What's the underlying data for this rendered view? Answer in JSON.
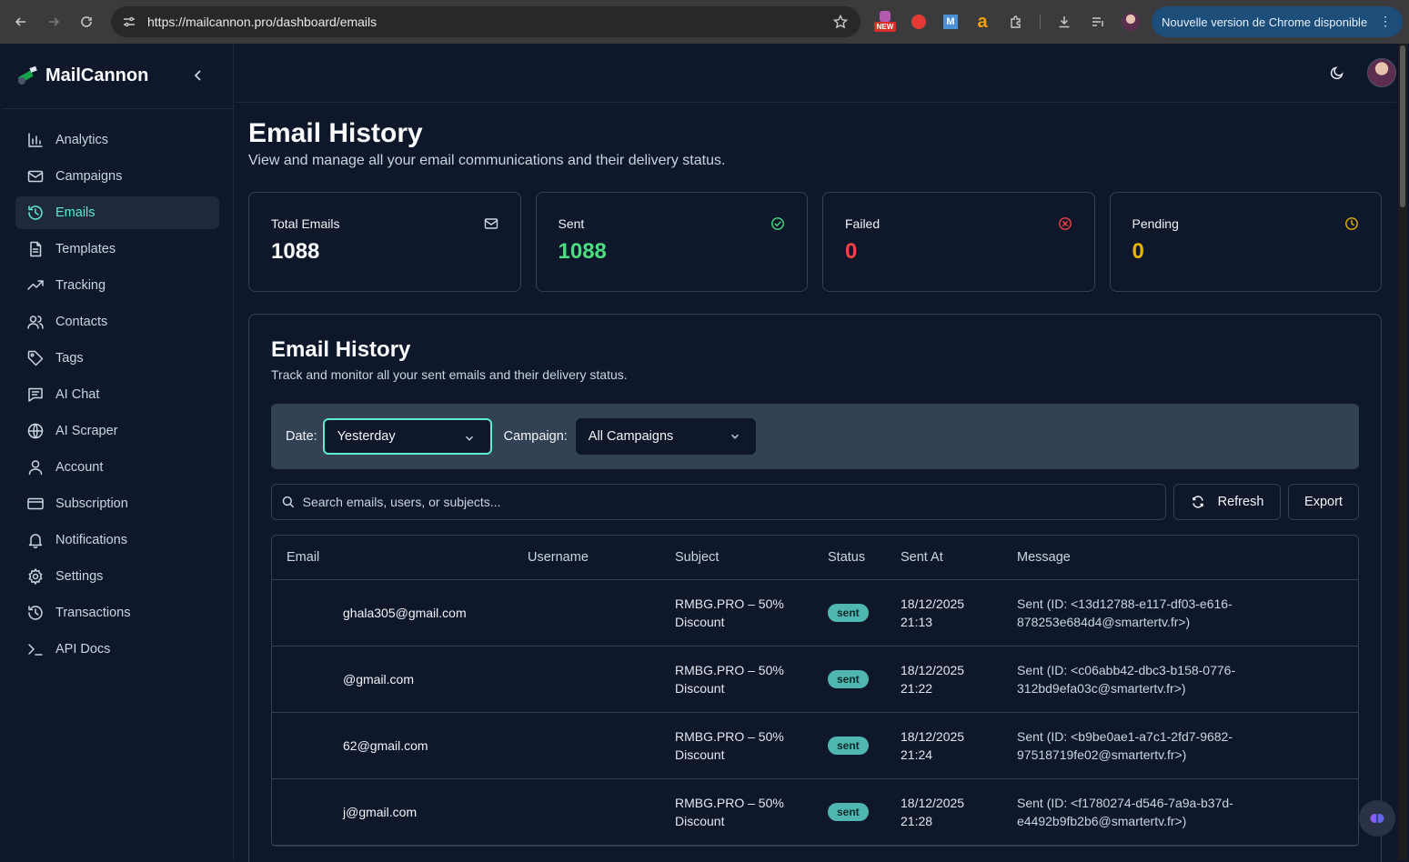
{
  "browser": {
    "url": "https://mailcannon.pro/dashboard/emails",
    "update_label": "Nouvelle version de Chrome disponible",
    "ext_new_badge": "NEW"
  },
  "sidebar": {
    "brand": "MailCannon",
    "items": [
      {
        "label": "Analytics",
        "icon": "bar-chart-icon"
      },
      {
        "label": "Campaigns",
        "icon": "mail-icon"
      },
      {
        "label": "Emails",
        "icon": "history-icon",
        "active": true
      },
      {
        "label": "Templates",
        "icon": "file-text-icon"
      },
      {
        "label": "Tracking",
        "icon": "trending-up-icon"
      },
      {
        "label": "Contacts",
        "icon": "users-icon"
      },
      {
        "label": "Tags",
        "icon": "tag-icon"
      },
      {
        "label": "AI Chat",
        "icon": "message-square-icon"
      },
      {
        "label": "AI Scraper",
        "icon": "globe-icon"
      },
      {
        "label": "Account",
        "icon": "user-icon"
      },
      {
        "label": "Subscription",
        "icon": "credit-card-icon"
      },
      {
        "label": "Notifications",
        "icon": "bell-icon"
      },
      {
        "label": "Settings",
        "icon": "gear-icon"
      },
      {
        "label": "Transactions",
        "icon": "history-icon"
      },
      {
        "label": "API Docs",
        "icon": "terminal-icon"
      }
    ]
  },
  "page": {
    "title": "Email History",
    "subtitle": "View and manage all your email communications and their delivery status."
  },
  "stats": [
    {
      "label": "Total Emails",
      "value": "1088",
      "color": "#f8fafc",
      "icon": "mail-icon"
    },
    {
      "label": "Sent",
      "value": "1088",
      "color": "#4ade80",
      "icon": "check-circle-icon"
    },
    {
      "label": "Failed",
      "value": "0",
      "color": "#ef4444",
      "icon": "x-circle-icon"
    },
    {
      "label": "Pending",
      "value": "0",
      "color": "#eab308",
      "icon": "clock-icon"
    }
  ],
  "history": {
    "title": "Email History",
    "subtitle": "Track and monitor all your sent emails and their delivery status.",
    "date_label": "Date:",
    "date_value": "Yesterday",
    "campaign_label": "Campaign:",
    "campaign_value": "All Campaigns",
    "search_placeholder": "Search emails, users, or subjects...",
    "refresh_label": "Refresh",
    "export_label": "Export"
  },
  "table": {
    "columns": [
      "Email",
      "Username",
      "Subject",
      "Status",
      "Sent At",
      "Message"
    ],
    "rows": [
      {
        "email": "ghala305@gmail.com",
        "username": "",
        "subject_1": "RMBG.PRO – 50%",
        "subject_2": "Discount",
        "status": "sent",
        "date": "18/12/2025",
        "time": "21:13",
        "msg_1": "Sent (ID: <13d12788-e117-df03-e616-",
        "msg_2": "878253e684d4@smartertv.fr>)"
      },
      {
        "email": "@gmail.com",
        "username": "",
        "subject_1": "RMBG.PRO – 50%",
        "subject_2": "Discount",
        "status": "sent",
        "date": "18/12/2025",
        "time": "21:22",
        "msg_1": "Sent (ID: <c06abb42-dbc3-b158-0776-",
        "msg_2": "312bd9efa03c@smartertv.fr>)"
      },
      {
        "email": "62@gmail.com",
        "username": "",
        "subject_1": "RMBG.PRO – 50%",
        "subject_2": "Discount",
        "status": "sent",
        "date": "18/12/2025",
        "time": "21:24",
        "msg_1": "Sent (ID: <b9be0ae1-a7c1-2fd7-9682-",
        "msg_2": "97518719fe02@smartertv.fr>)"
      },
      {
        "email": "j@gmail.com",
        "username": "",
        "subject_1": "RMBG.PRO – 50%",
        "subject_2": "Discount",
        "status": "sent",
        "date": "18/12/2025",
        "time": "21:28",
        "msg_1": "Sent (ID: <f1780274-d546-7a9a-b37d-",
        "msg_2": "e4492b9fb2b6@smartertv.fr>)"
      }
    ]
  }
}
